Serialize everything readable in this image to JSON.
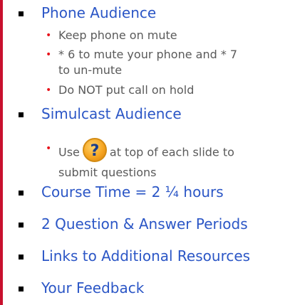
{
  "phone_audience": {
    "title": "Phone Audience",
    "items": [
      "Keep phone on mute",
      "* 6 to mute your phone and * 7 to un-mute",
      "Do NOT put call on hold"
    ]
  },
  "simulcast_audience": {
    "title": "Simulcast Audience",
    "item_prefix": "Use",
    "icon": "help-question-icon",
    "item_suffix": "at top of each slide to submit questions"
  },
  "course_time": "Course Time = 2 ¼ hours",
  "qa_periods": "2 Question & Answer Periods",
  "links": "Links to Additional Resources",
  "feedback": "Your Feedback",
  "colors": {
    "heading": "#2b56c6",
    "sub_bullet": "#e8141c",
    "sub_text": "#5a5a5a",
    "left_rule": "#c8102e"
  }
}
